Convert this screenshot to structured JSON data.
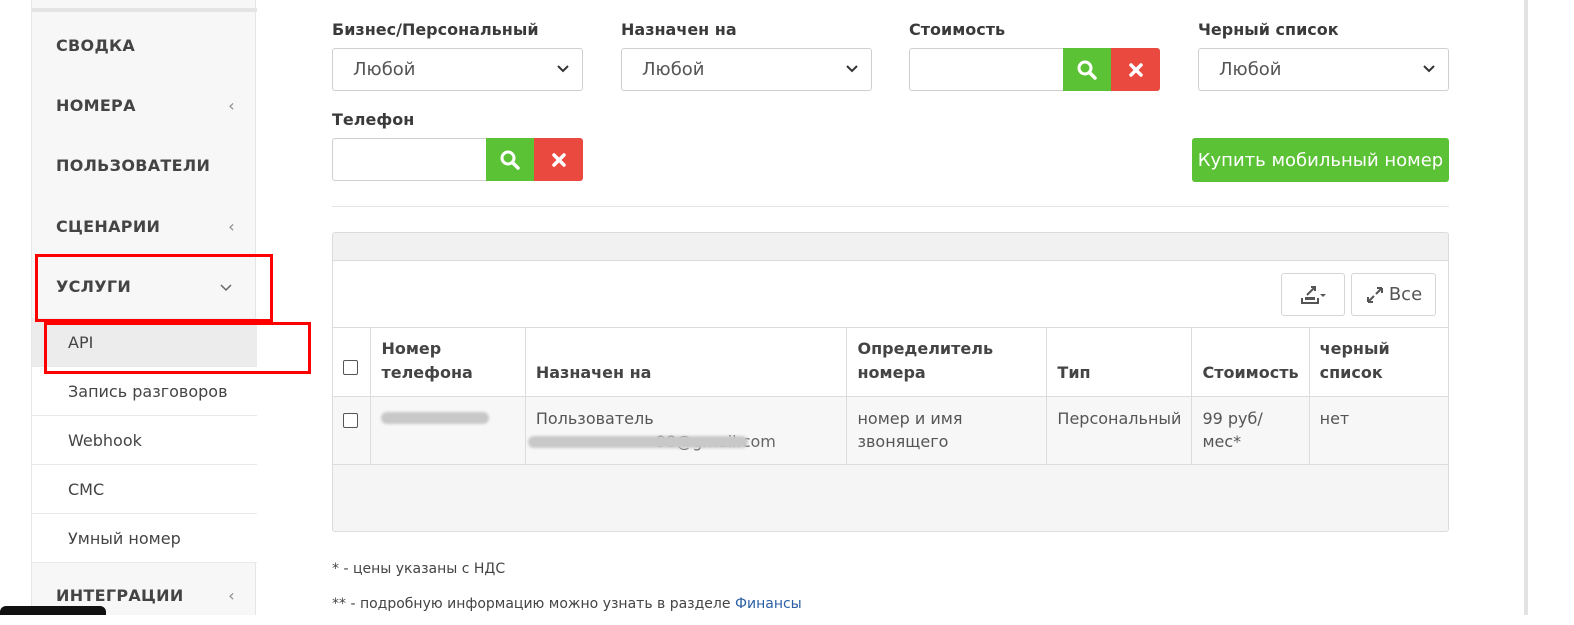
{
  "sidebar": {
    "items": [
      {
        "label": "СВОДКА"
      },
      {
        "label": "НОМЕРА",
        "chevron": "‹"
      },
      {
        "label": "ПОЛЬЗОВАТЕЛИ"
      },
      {
        "label": "СЦЕНАРИИ",
        "chevron": "‹"
      },
      {
        "label": "УСЛУГИ",
        "chevron": "⌄"
      }
    ],
    "subitems": [
      {
        "label": "API"
      },
      {
        "label": "Запись разговоров"
      },
      {
        "label": "Webhook"
      },
      {
        "label": "СМС"
      },
      {
        "label": "Умный номер"
      }
    ],
    "bottom_item": {
      "label": "ИНТЕГРАЦИИ",
      "chevron": "‹"
    }
  },
  "filters": {
    "business_personal": {
      "label": "Бизнес/Персональный",
      "value": "Любой"
    },
    "assigned_to": {
      "label": "Назначен на",
      "value": "Любой"
    },
    "cost": {
      "label": "Стоимость",
      "value": ""
    },
    "blacklist": {
      "label": "Черный список",
      "value": "Любой"
    },
    "phone": {
      "label": "Телефон",
      "value": ""
    }
  },
  "buy_button": "Купить мобильный номер",
  "toolbar": {
    "export_icon": "export-icon",
    "expand_label": "Все"
  },
  "table": {
    "headers": [
      "Номер телефона",
      "Назначен на",
      "Определитель номера",
      "Тип",
      "Стоимость",
      "черный список"
    ],
    "rows": [
      {
        "phone": "",
        "assigned_user": "Пользователь",
        "assigned_email_tail": "98@gmail.com",
        "caller_id": "номер и имя звонящего",
        "type": "Персональный",
        "cost": "99 руб/мес*",
        "blacklist": "нет"
      }
    ]
  },
  "notes": {
    "vat": "* - цены указаны с НДС",
    "info_prefix": "** - подробную информацию можно узнать в разделе",
    "info_link": "Финансы"
  },
  "colors": {
    "green": "#5bc236",
    "red": "#e9493f",
    "highlight": "#ff0000",
    "link": "#2a5fa5"
  }
}
